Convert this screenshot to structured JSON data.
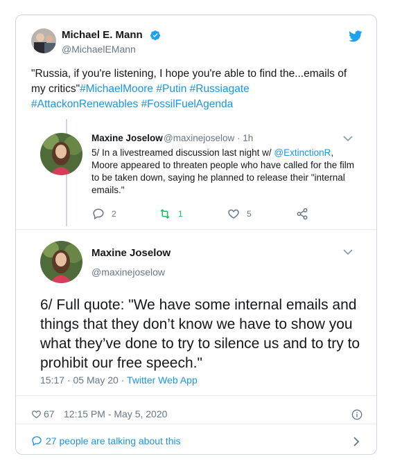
{
  "author": {
    "name": "Michael E. Mann",
    "handle": "@MichaelEMann"
  },
  "tweet": {
    "quote_text": "\"Russia, if you're listening, I hope you're able to find the...emails of my critics\"",
    "hashtags": [
      "#MichaelMoore",
      "#Putin",
      "#Russiagate",
      "#AttackonRenewables",
      "#FossilFuelAgenda"
    ]
  },
  "quoted_1": {
    "name": "Maxine Joselow",
    "meta": "@maxinejoselow · 1h",
    "text_before": "5/ In a livestreamed discussion last night w/ ",
    "mention": "@ExtinctionR",
    "text_after": ", Moore appeared to threaten people who have called for the film to be taken down, saying he planned to release their \"internal emails.\"",
    "replies": "2",
    "retweets": "1",
    "likes": "5"
  },
  "quoted_2": {
    "name": "Maxine Joselow",
    "handle": "@maxinejoselow",
    "text": "6/ Full quote: \"We have some internal emails and things that they don’t know we have to show you what they’ve done to try to silence us and to try to prohibit our free speech.\"",
    "timestamp": "15:17 · 05 May 20 · ",
    "source": "Twitter Web App"
  },
  "footer": {
    "likes": "67",
    "time": "12:15 PM - May 5, 2020",
    "talking": "27 people are talking about this"
  },
  "icons": {
    "verified": "verified-badge-icon",
    "bird": "twitter-bird-icon",
    "reply": "reply-icon",
    "retweet": "retweet-icon",
    "like": "heart-icon",
    "share": "share-icon",
    "info": "info-icon",
    "comment": "comment-icon"
  },
  "colors": {
    "link": "#1b95e0",
    "retweet": "#17bf63",
    "muted": "#657786",
    "text": "#14171a",
    "border": "#ccd6dd"
  }
}
